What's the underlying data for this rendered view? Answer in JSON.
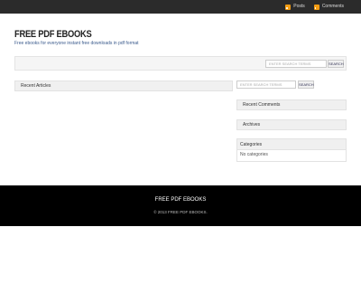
{
  "topbar": {
    "posts_label": "Posts",
    "comments_label": "Comments",
    "icon": "rss-icon"
  },
  "header": {
    "site_title": "FREE PDF EBOOKS",
    "site_description": "Free ebooks for everyone instant free downloads in pdf format"
  },
  "navbar": {
    "search_placeholder": "ENTER SEARCH TERMS",
    "search_button": "SEARCH"
  },
  "main": {
    "recent_articles_title": "Recent Articles"
  },
  "sidebar": {
    "search_placeholder": "ENTER SEARCH TERMS",
    "search_button": "SEARCH",
    "recent_comments_title": "Recent Comments",
    "archives_title": "Archives",
    "categories_title": "Categories",
    "categories_empty": "No categories"
  },
  "footer": {
    "title": "FREE PDF EBOOKS",
    "copyright": "© 2013 FREE PDF EBOOKS."
  }
}
